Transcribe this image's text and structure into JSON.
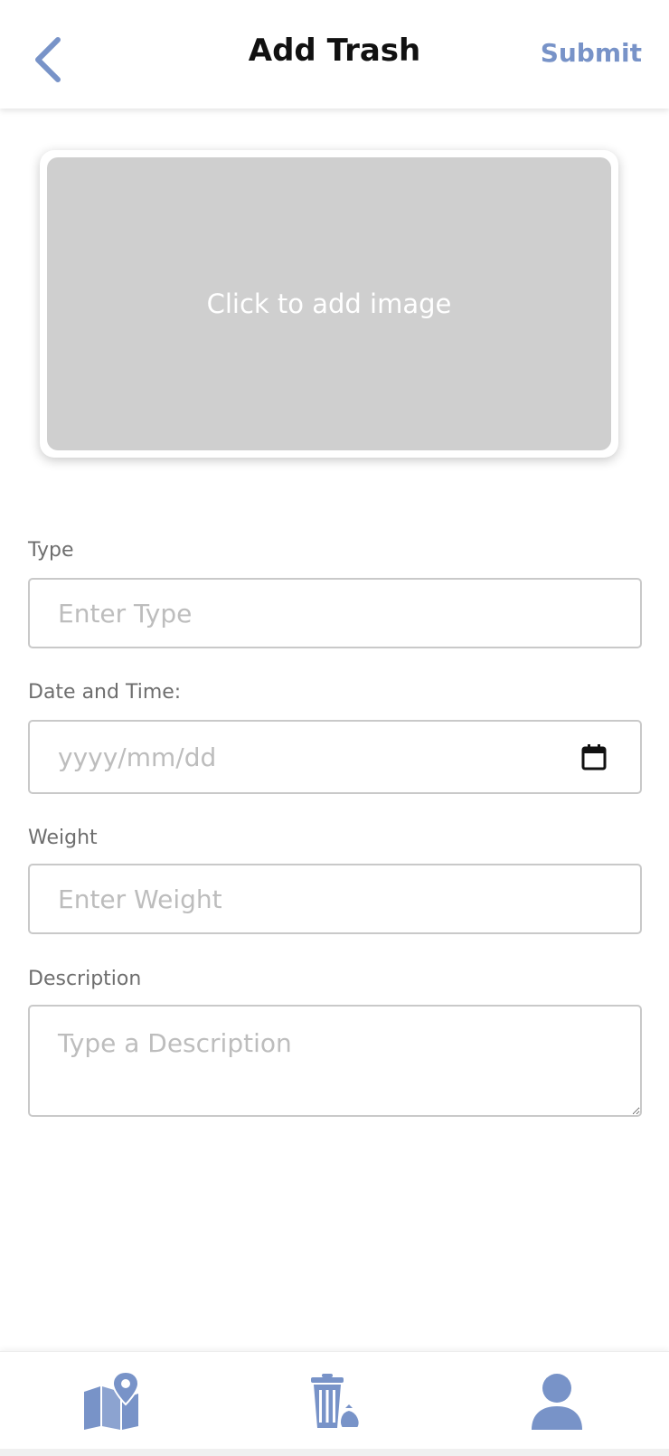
{
  "header": {
    "title": "Add Trash",
    "submit_label": "Submit"
  },
  "image_upload": {
    "label": "Click to add image"
  },
  "form": {
    "type": {
      "label": "Type",
      "placeholder": "Enter Type"
    },
    "datetime": {
      "label": "Date and Time:",
      "placeholder": "yyyy/mm/dd"
    },
    "weight": {
      "label": "Weight",
      "placeholder": "Enter Weight"
    },
    "description": {
      "label": "Description",
      "placeholder": "Type a Description"
    }
  },
  "nav": {
    "items": [
      {
        "icon": "map-location-icon"
      },
      {
        "icon": "trash-bin-icon"
      },
      {
        "icon": "user-profile-icon"
      }
    ]
  },
  "colors": {
    "accent": "#7893c8",
    "placeholder_bg": "#cfcfcf"
  }
}
